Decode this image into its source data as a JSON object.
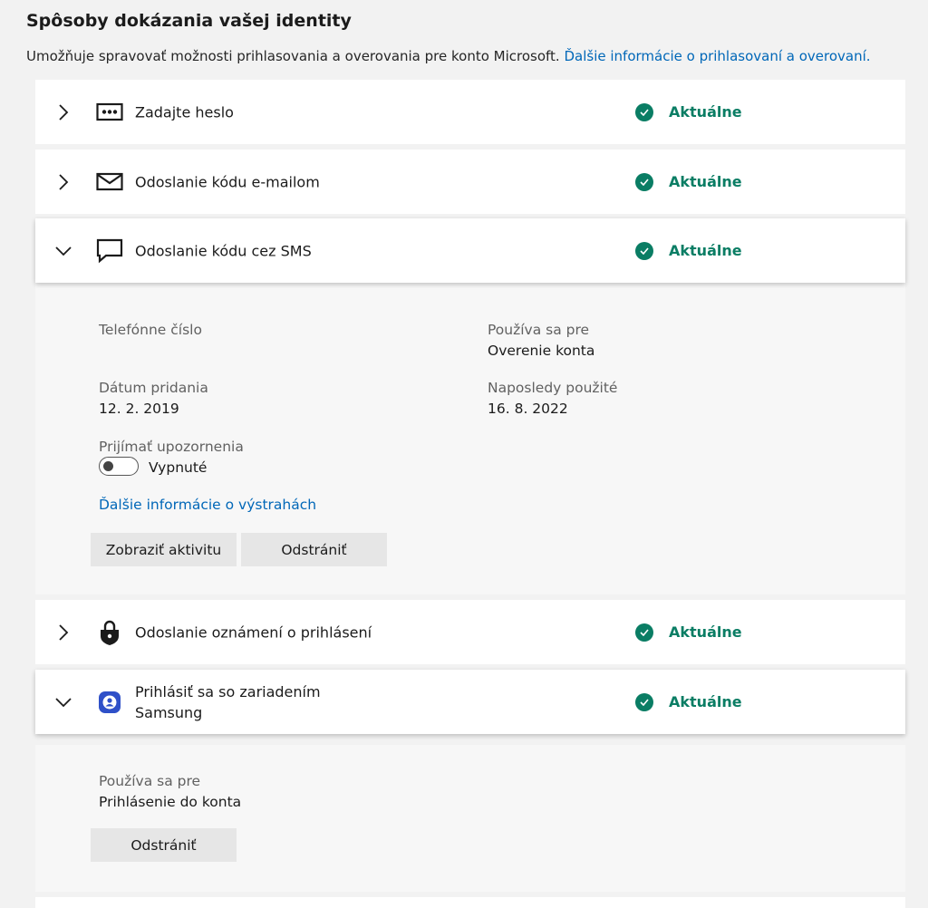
{
  "header": {
    "title": "Spôsoby dokázania vašej identity",
    "description": "Umožňuje spravovať možnosti prihlasovania a overovania pre konto Microsoft.",
    "description_link": "Ďalšie informácie o prihlasovaní a overovaní."
  },
  "colors": {
    "accent": "#0a7d64",
    "link": "#0067b8"
  },
  "methods": [
    {
      "label": "Zadajte heslo",
      "icon": "password-dots-icon",
      "status": "Aktuálne",
      "expanded": false
    },
    {
      "label": "Odoslanie kódu e-mailom",
      "icon": "envelope-icon",
      "status": "Aktuálne",
      "expanded": false
    },
    {
      "label": "Odoslanie kódu cez SMS",
      "icon": "chat-bubble-icon",
      "status": "Aktuálne",
      "expanded": true
    },
    {
      "label": "Odoslanie oznámení o prihlásení",
      "icon": "lock-shield-icon",
      "status": "Aktuálne",
      "expanded": false
    },
    {
      "label": "Prihlásiť sa so zariadením Samsung",
      "icon": "samsung-account-icon",
      "status": "Aktuálne",
      "expanded": true
    }
  ],
  "sms_details": {
    "phone_label": "Telefónne číslo",
    "used_for_label": "Používa sa pre",
    "used_for_value": "Overenie konta",
    "date_added_label": "Dátum pridania",
    "date_added_value": "12. 2. 2019",
    "last_used_label": "Naposledy použité",
    "last_used_value": "16. 8. 2022",
    "alerts_label": "Prijímať upozornenia",
    "alerts_state": "Vypnuté",
    "alerts_on": false,
    "more_info_link": "Ďalšie informácie o výstrahách",
    "view_activity_button": "Zobraziť aktivitu",
    "remove_button": "Odstrániť"
  },
  "samsung_details": {
    "used_for_label": "Používa sa pre",
    "used_for_value": "Prihlásenie do konta",
    "remove_button": "Odstrániť"
  }
}
